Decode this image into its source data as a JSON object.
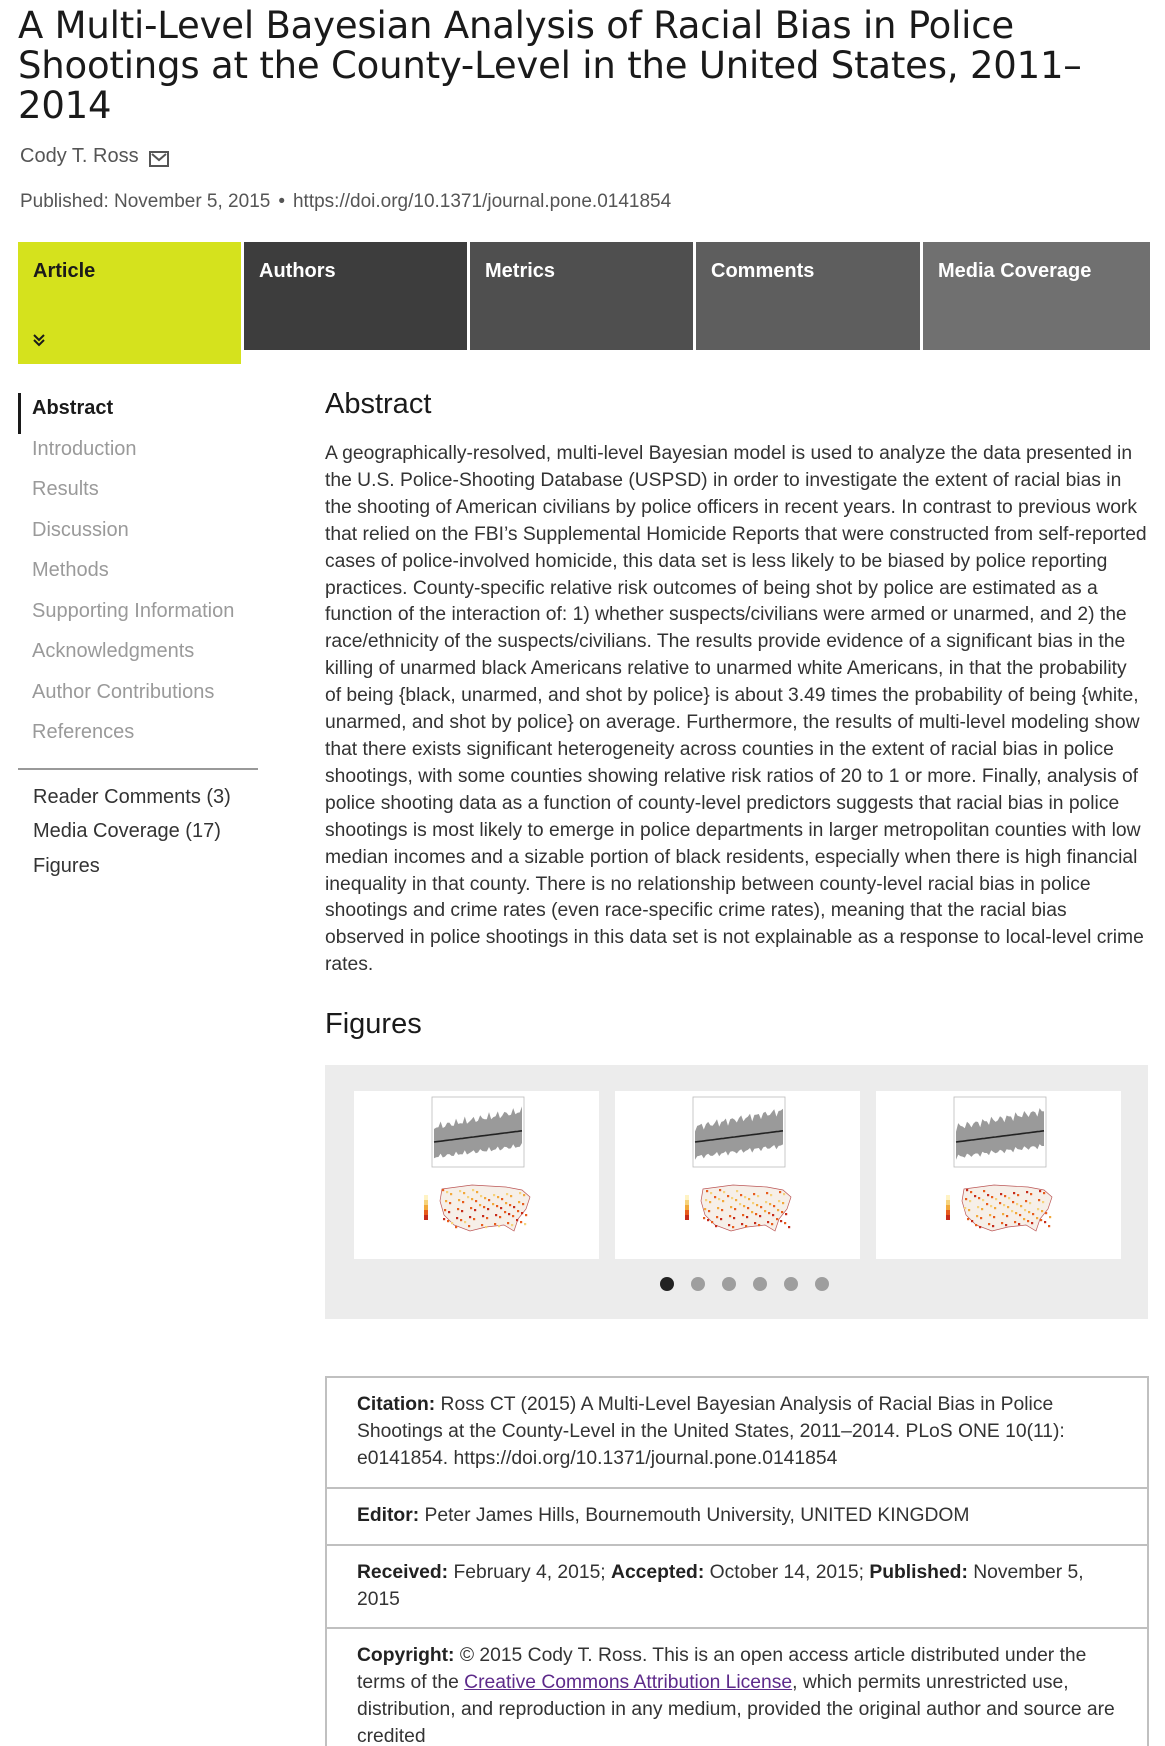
{
  "article": {
    "title": "A Multi-Level Bayesian Analysis of Racial Bias in Police Shootings at the County-Level in the United States, 2011–2014",
    "author": "Cody T. Ross",
    "published": "Published: November 5, 2015",
    "bullet": "•",
    "doi": "https://doi.org/10.1371/journal.pone.0141854"
  },
  "tabs": [
    {
      "label": "Article",
      "active": true,
      "chevron": "»"
    },
    {
      "label": "Authors"
    },
    {
      "label": "Metrics"
    },
    {
      "label": "Comments"
    },
    {
      "label": "Media Coverage"
    }
  ],
  "sidenav": {
    "sections": [
      "Abstract",
      "Introduction",
      "Results",
      "Discussion",
      "Methods",
      "Supporting Information",
      "Acknowledgments",
      "Author Contributions",
      "References"
    ],
    "extras": [
      "Reader Comments (3)",
      "Media Coverage (17)",
      "Figures"
    ]
  },
  "abstract": {
    "heading": "Abstract",
    "text": "A geographically-resolved, multi-level Bayesian model is used to analyze the data presented in the U.S. Police-Shooting Database (USPSD) in order to investigate the extent of racial bias in the shooting of American civilians by police officers in recent years. In contrast to previous work that relied on the FBI’s Supplemental Homicide Reports that were constructed from self-reported cases of police-involved homicide, this data set is less likely to be biased by police reporting practices. County-specific relative risk outcomes of being shot by police are estimated as a function of the interaction of: 1) whether suspects/civilians were armed or unarmed, and 2) the race/ethnicity of the suspects/civilians. The results provide evidence of a significant bias in the killing of unarmed black Americans relative to unarmed white Americans, in that the probability of being {black, unarmed, and shot by police} is about 3.49 times the probability of being {white, unarmed, and shot by police} on average. Furthermore, the results of multi-level modeling show that there exists significant heterogeneity across counties in the extent of racial bias in police shootings, with some counties showing relative risk ratios of 20 to 1 or more. Finally, analysis of police shooting data as a function of county-level predictors suggests that racial bias in police shootings is most likely to emerge in police departments in larger metropolitan counties with low median incomes and a sizable portion of black residents, especially when there is high financial inequality in that county. There is no relationship between county-level racial bias in police shootings and crime rates (even race-specific crime rates), meaning that the racial bias observed in police shootings in this data set is not explainable as a response to local-level crime rates."
  },
  "figures": {
    "heading": "Figures",
    "thumbnail_count": 3,
    "dot_count": 6,
    "active_dot": 0
  },
  "citation": {
    "label": "Citation:",
    "text": " Ross CT (2015) A Multi-Level Bayesian Analysis of Racial Bias in Police Shootings at the County-Level in the United States, 2011–2014. PLoS ONE 10(11): e0141854. https://doi.org/10.1371/journal.pone.0141854"
  },
  "editor": {
    "label": "Editor:",
    "text": " Peter James Hills, Bournemouth University, UNITED KINGDOM"
  },
  "dates": {
    "received_label": "Received:",
    "received": " February 4, 2015; ",
    "accepted_label": "Accepted:",
    "accepted": " October 14, 2015; ",
    "published_label": "Published:",
    "published": " November 5, 2015"
  },
  "copyright": {
    "label": "Copyright:",
    "text_before": " © 2015 Cody T. Ross. This is an open access article distributed under the terms of the ",
    "link": "Creative Commons Attribution License",
    "text_after": ", which permits unrestricted use, distribution, and reproduction in any medium, provided the original author and source are credited"
  },
  "colors": {
    "active_tab": "#d5e21d",
    "link": "#5d2a8a"
  }
}
